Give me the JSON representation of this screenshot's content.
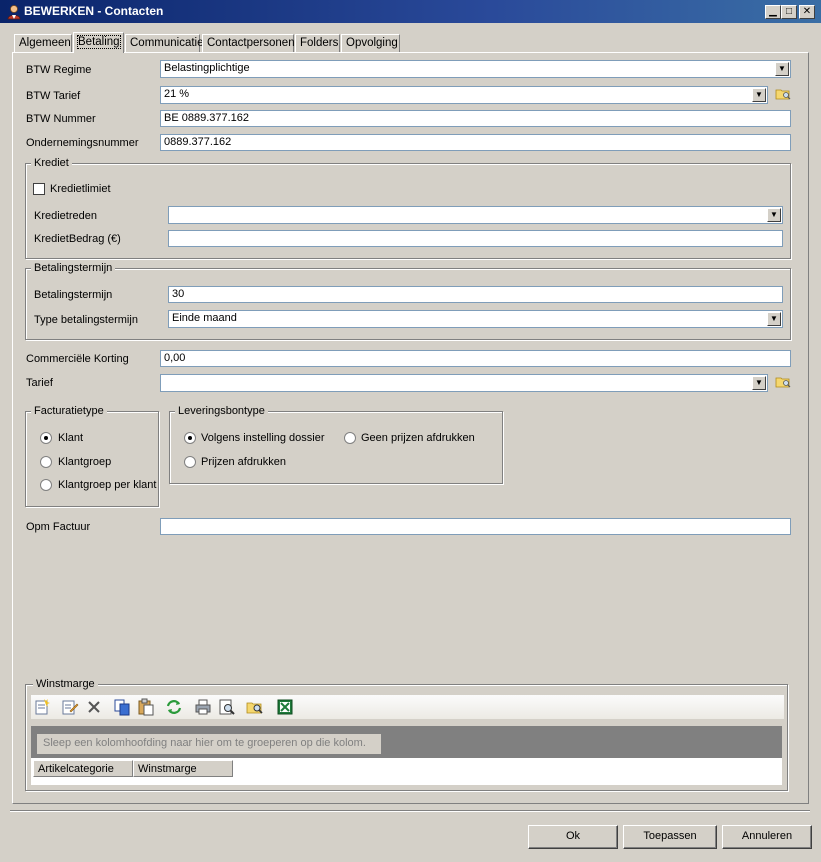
{
  "window": {
    "title": "BEWERKEN - Contacten"
  },
  "tabs": [
    "Algemeen",
    "Betaling",
    "Communicatie",
    "Contactpersonen",
    "Folders",
    "Opvolging"
  ],
  "form": {
    "btw_regime": {
      "label": "BTW Regime",
      "value": "Belastingplichtige"
    },
    "btw_tarief": {
      "label": "BTW Tarief",
      "value": "21 %"
    },
    "btw_nummer": {
      "label": "BTW Nummer",
      "value": "BE 0889.377.162"
    },
    "ondernemingsnummer": {
      "label": "Ondernemingsnummer",
      "value": "0889.377.162"
    },
    "commerciele_korting": {
      "label": "Commerciële Korting",
      "value": "0,00"
    },
    "tarief": {
      "label": "Tarief",
      "value": ""
    },
    "opm_factuur": {
      "label": "Opm Factuur",
      "value": ""
    }
  },
  "krediet": {
    "legend": "Krediet",
    "kredietlimiet": {
      "label": "Kredietlimiet",
      "checked": false
    },
    "kredietreden": {
      "label": "Kredietreden",
      "value": ""
    },
    "kredietbedrag": {
      "label": "KredietBedrag (€)",
      "value": ""
    }
  },
  "betalingstermijn": {
    "legend": "Betalingstermijn",
    "termijn": {
      "label": "Betalingstermijn",
      "value": "30"
    },
    "type": {
      "label": "Type betalingstermijn",
      "value": "Einde maand"
    }
  },
  "facturatietype": {
    "legend": "Facturatietype",
    "options": [
      "Klant",
      "Klantgroep",
      "Klantgroep per klant"
    ],
    "selected": "Klant"
  },
  "leveringsbontype": {
    "legend": "Leveringsbontype",
    "options": [
      "Volgens instelling dossier",
      "Geen prijzen afdrukken",
      "Prijzen afdrukken"
    ],
    "selected": "Volgens instelling dossier"
  },
  "winstmarge": {
    "legend": "Winstmarge",
    "group_hint": "Sleep een kolomhoofding naar hier om te groeperen op die kolom.",
    "columns": [
      "Artikelcategorie",
      "Winstmarge"
    ],
    "toolbar_icons": [
      "new-icon",
      "edit-icon",
      "delete-icon",
      "copy-icon",
      "paste-icon",
      "refresh-icon",
      "print-icon",
      "print-preview-icon",
      "find-icon",
      "excel-icon"
    ]
  },
  "buttons": {
    "ok": "Ok",
    "apply": "Toepassen",
    "cancel": "Annuleren"
  },
  "colors": {
    "titlebar": "#0a246a",
    "face": "#d4d0c8",
    "grid_group_area": "#808080"
  }
}
